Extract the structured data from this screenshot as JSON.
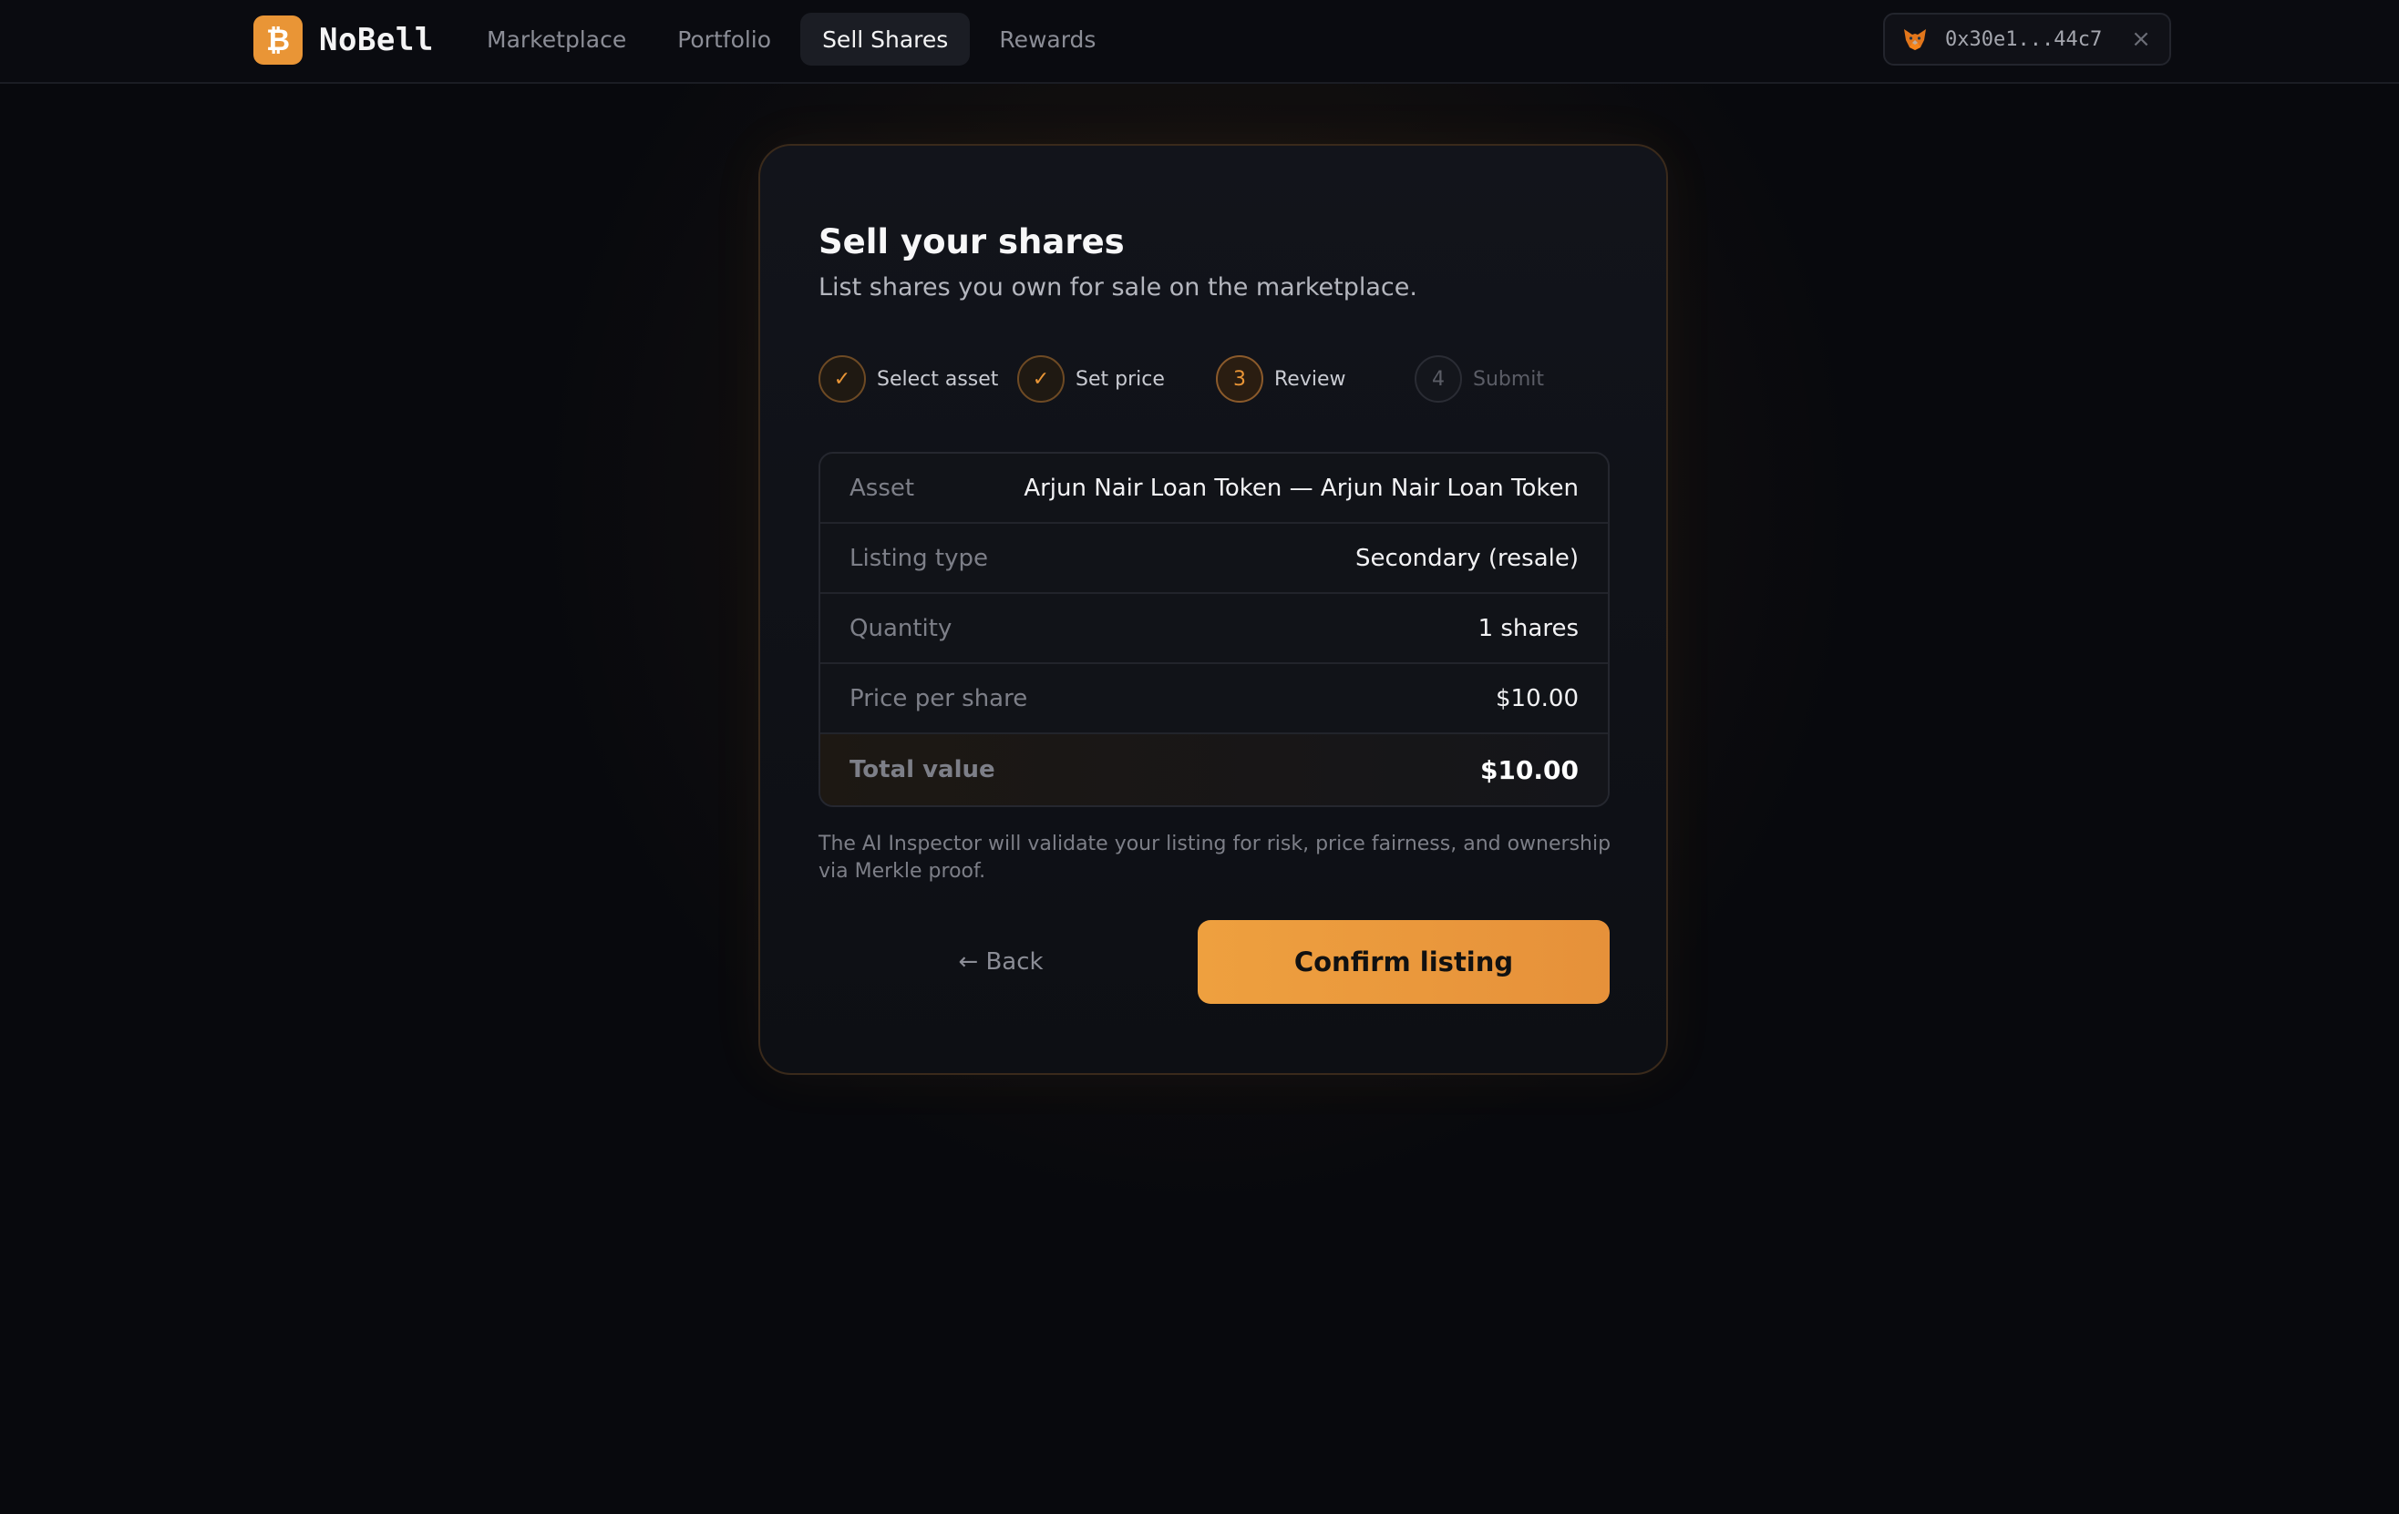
{
  "brand": {
    "logo_glyph": "₿",
    "name": "NoBell",
    "accent": "#e99536"
  },
  "nav": {
    "items": [
      {
        "label": "Marketplace",
        "active": false
      },
      {
        "label": "Portfolio",
        "active": false
      },
      {
        "label": "Sell Shares",
        "active": true
      },
      {
        "label": "Rewards",
        "active": false
      }
    ]
  },
  "wallet": {
    "icon": "metamask-fox-icon",
    "address": "0x30e1...44c7",
    "close_glyph": "×"
  },
  "card": {
    "title": "Sell your shares",
    "subtitle": "List shares you own for sale on the marketplace."
  },
  "steps": [
    {
      "marker": "✓",
      "label": "Select asset",
      "state": "done"
    },
    {
      "marker": "✓",
      "label": "Set price",
      "state": "done"
    },
    {
      "marker": "3",
      "label": "Review",
      "state": "current"
    },
    {
      "marker": "4",
      "label": "Submit",
      "state": "pending"
    }
  ],
  "summary": {
    "rows": [
      {
        "label": "Asset",
        "value": "Arjun Nair Loan Token — Arjun Nair Loan Token"
      },
      {
        "label": "Listing type",
        "value": "Secondary (resale)"
      },
      {
        "label": "Quantity",
        "value": "1 shares"
      },
      {
        "label": "Price per share",
        "value": "$10.00"
      }
    ],
    "total": {
      "label": "Total value",
      "value": "$10.00"
    }
  },
  "note": "The AI Inspector will validate your listing for risk, price fairness, and ownership via Merkle proof.",
  "actions": {
    "back_label": "← Back",
    "confirm_label": "Confirm listing"
  }
}
